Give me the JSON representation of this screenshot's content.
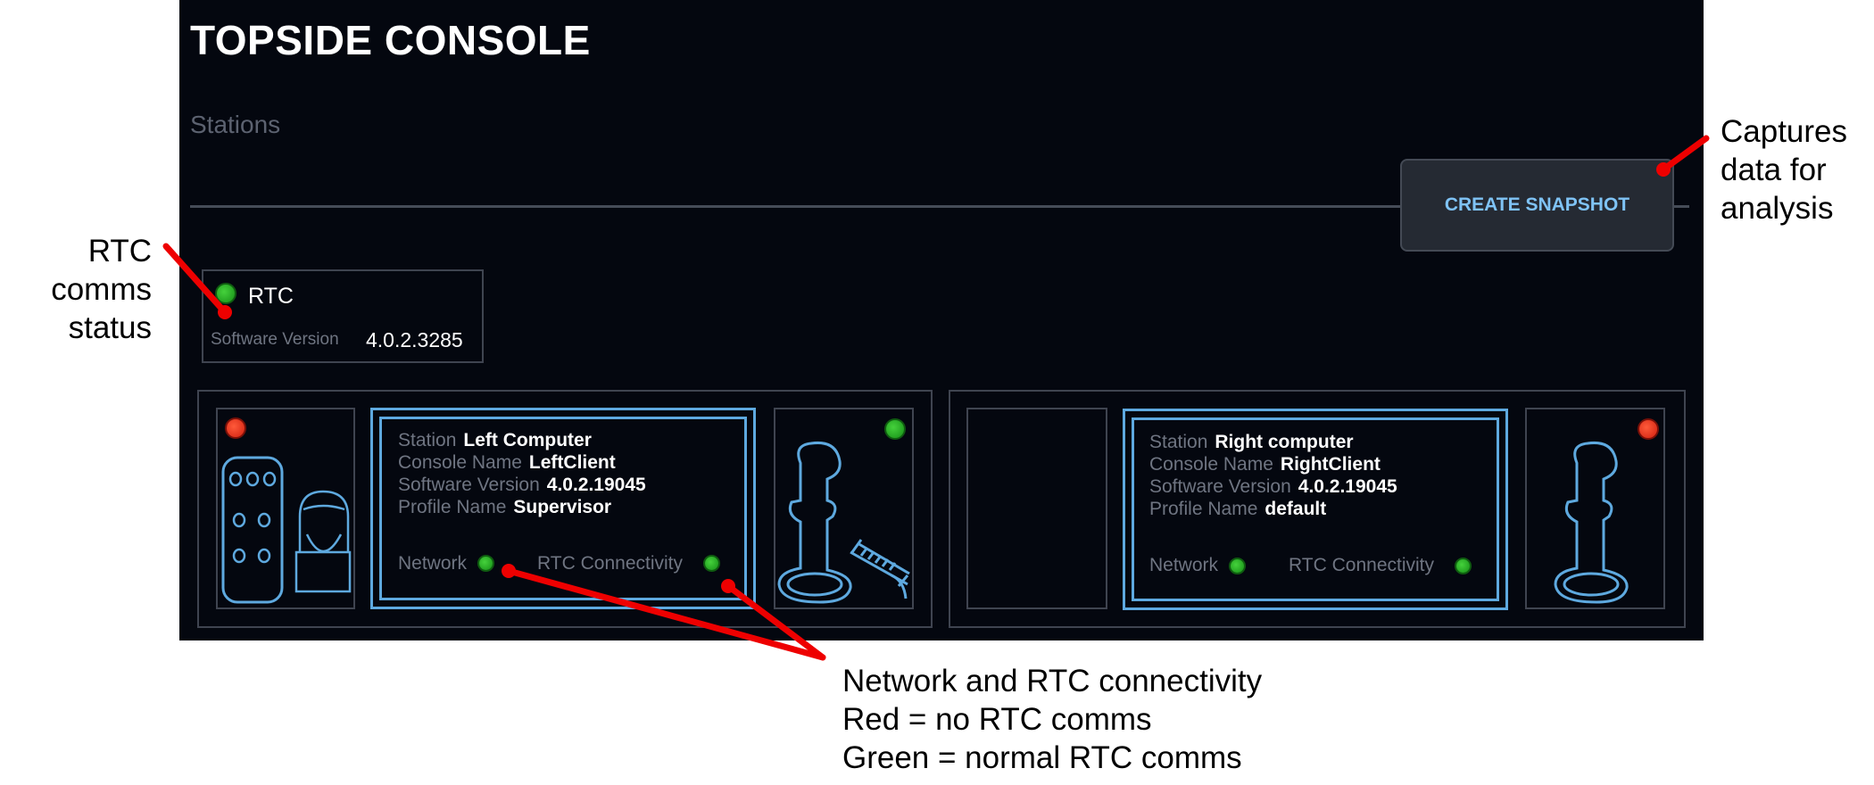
{
  "header": {
    "title": "TOPSIDE CONSOLE",
    "subtitle": "Stations"
  },
  "toolbar": {
    "snapshot_label": "CREATE SNAPSHOT"
  },
  "rtc": {
    "label": "RTC",
    "software_version_label": "Software Version",
    "software_version": "4.0.2.3285",
    "status": "green"
  },
  "stations": [
    {
      "station_label": "Station",
      "station": "Left Computer",
      "console_name_label": "Console Name",
      "console_name": "LeftClient",
      "software_version_label": "Software Version",
      "software_version": "4.0.2.19045",
      "profile_name_label": "Profile Name",
      "profile_name": "Supervisor",
      "network_label": "Network",
      "network_status": "green",
      "rtc_label": "RTC Connectivity",
      "rtc_status": "green",
      "left_device_status": "red",
      "right_device_status": "green"
    },
    {
      "station_label": "Station",
      "station": "Right computer",
      "console_name_label": "Console Name",
      "console_name": "RightClient",
      "software_version_label": "Software Version",
      "software_version": "4.0.2.19045",
      "profile_name_label": "Profile Name",
      "profile_name": "default",
      "network_label": "Network",
      "network_status": "green",
      "rtc_label": "RTC Connectivity",
      "rtc_status": "green",
      "right_device_status": "red"
    }
  ],
  "annotations": {
    "rtc_comms": [
      "RTC",
      "comms",
      "status"
    ],
    "snapshot": [
      "Captures",
      "data for",
      "analysis"
    ],
    "connectivity": [
      "Network and RTC connectivity",
      "Red = no RTC comms",
      "Green = normal RTC comms"
    ]
  },
  "colors": {
    "accent": "#5ea9df",
    "button_text": "#7fc3f5",
    "ok": "#2fb52a",
    "error": "#e8321c",
    "annotation_arrow": "#ee0000"
  }
}
